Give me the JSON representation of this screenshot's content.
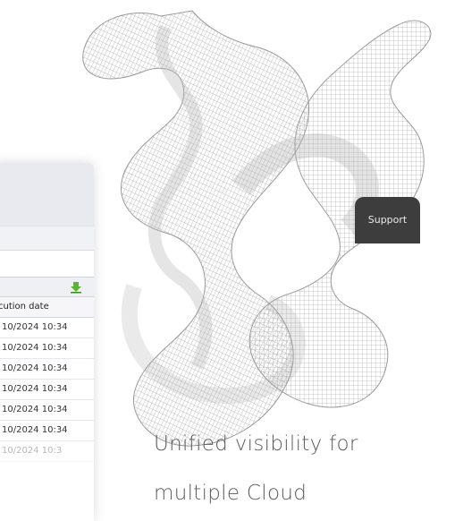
{
  "app": {
    "support_tab_label": "Support"
  },
  "grid": {
    "column_header": "cution date",
    "download_icon": "download-arrow-icon",
    "rows": [
      "10/2024 10:34",
      "10/2024 10:34",
      "10/2024 10:34",
      "10/2024 10:34",
      "10/2024 10:34",
      "10/2024 10:34",
      "10/2024 10:3"
    ]
  },
  "hero": {
    "headline_line1": "Unified visibility for",
    "headline_line2": "multiple Cloud"
  },
  "colors": {
    "support_tab_bg": "#3d3d3d",
    "download_icon_green": "#5cb531",
    "headline_text": "#5b5b5b"
  }
}
